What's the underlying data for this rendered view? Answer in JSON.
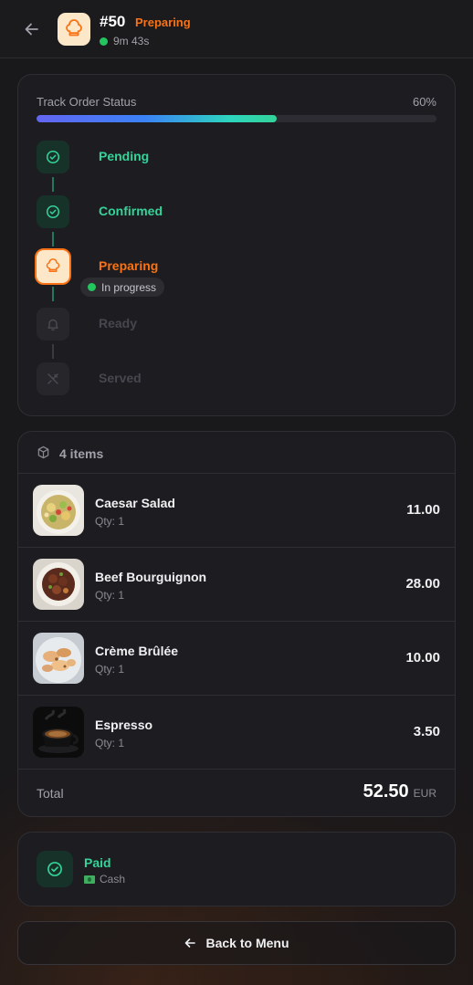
{
  "header": {
    "order_number": "#50",
    "status": "Preparing",
    "elapsed": "9m 43s"
  },
  "tracking": {
    "title": "Track Order Status",
    "percent_label": "60%",
    "progress": 0.6,
    "steps": [
      {
        "label": "Pending",
        "state": "done",
        "icon": "check-circle-icon"
      },
      {
        "label": "Confirmed",
        "state": "done",
        "icon": "check-circle-icon"
      },
      {
        "label": "Preparing",
        "state": "active",
        "icon": "chef-hat-icon"
      },
      {
        "label": "Ready",
        "state": "pending",
        "icon": "bell-icon"
      },
      {
        "label": "Served",
        "state": "pending",
        "icon": "utensils-crossed-icon"
      }
    ],
    "active_badge": "In progress"
  },
  "order": {
    "items_count_label": "4 items",
    "items": [
      {
        "name": "Caesar Salad",
        "qty": "Qty: 1",
        "price": "11.00"
      },
      {
        "name": "Beef Bourguignon",
        "qty": "Qty: 1",
        "price": "28.00"
      },
      {
        "name": "Crème Brûlée",
        "qty": "Qty: 1",
        "price": "10.00"
      },
      {
        "name": "Espresso",
        "qty": "Qty: 1",
        "price": "3.50"
      }
    ],
    "total_label": "Total",
    "total_value": "52.50",
    "currency": "EUR"
  },
  "payment": {
    "status": "Paid",
    "method": "Cash"
  },
  "actions": {
    "back_label": "Back to Menu"
  },
  "colors": {
    "accent_orange": "#f97316",
    "success_green": "#34d399",
    "background": "#19181a",
    "card": "#1d1d21"
  }
}
